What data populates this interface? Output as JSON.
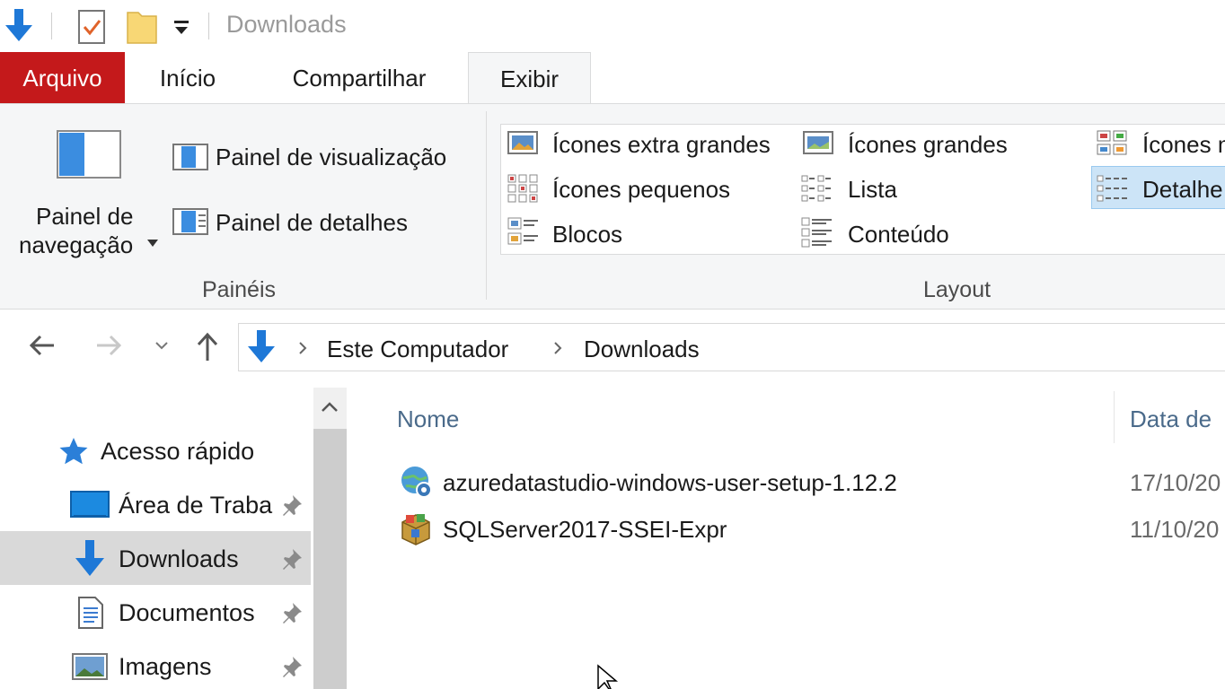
{
  "window": {
    "title": "Downloads"
  },
  "quick_access_toolbar": {
    "icons": [
      "down-arrow-icon",
      "properties-icon",
      "new-folder-icon",
      "customize-dropdown-icon"
    ]
  },
  "ribbon_tabs": [
    {
      "label": "Arquivo"
    },
    {
      "label": "Início"
    },
    {
      "label": "Compartilhar"
    },
    {
      "label": "Exibir",
      "active": true
    }
  ],
  "ribbon": {
    "paineis": {
      "group_label": "Painéis",
      "nav_pane_line1": "Painel de",
      "nav_pane_line2": "navegação",
      "preview_pane": "Painel de visualização",
      "details_pane": "Painel de detalhes"
    },
    "layout": {
      "group_label": "Layout",
      "items": [
        "Ícones extra grandes",
        "Ícones grandes",
        "Ícones m",
        "Ícones pequenos",
        "Lista",
        "Detalhe",
        "Blocos",
        "Conteúdo"
      ],
      "selected": "Detalhe"
    }
  },
  "address_bar": {
    "breadcrumb": [
      "Este Computador",
      "Downloads"
    ]
  },
  "nav_pane": {
    "items": [
      {
        "label": "Acesso rápido",
        "icon": "star-icon"
      },
      {
        "label": "Área de Traba",
        "icon": "desktop-icon",
        "pinned": true
      },
      {
        "label": "Downloads",
        "icon": "download-icon",
        "pinned": true,
        "selected": true
      },
      {
        "label": "Documentos",
        "icon": "document-icon",
        "pinned": true
      },
      {
        "label": "Imagens",
        "icon": "image-icon",
        "pinned": true
      }
    ]
  },
  "file_list": {
    "columns": [
      "Nome",
      "Data de"
    ],
    "rows": [
      {
        "name": "azuredatastudio-windows-user-setup-1.12.2",
        "date": "17/10/20",
        "icon": "installer-globe-icon"
      },
      {
        "name": "SQLServer2017-SSEI-Expr",
        "date": "11/10/20",
        "icon": "installer-box-icon"
      }
    ]
  },
  "colors": {
    "arquivo_tab": "#c4191b",
    "accent_blue": "#1e78d7",
    "selection_bg": "#cce4f7"
  }
}
